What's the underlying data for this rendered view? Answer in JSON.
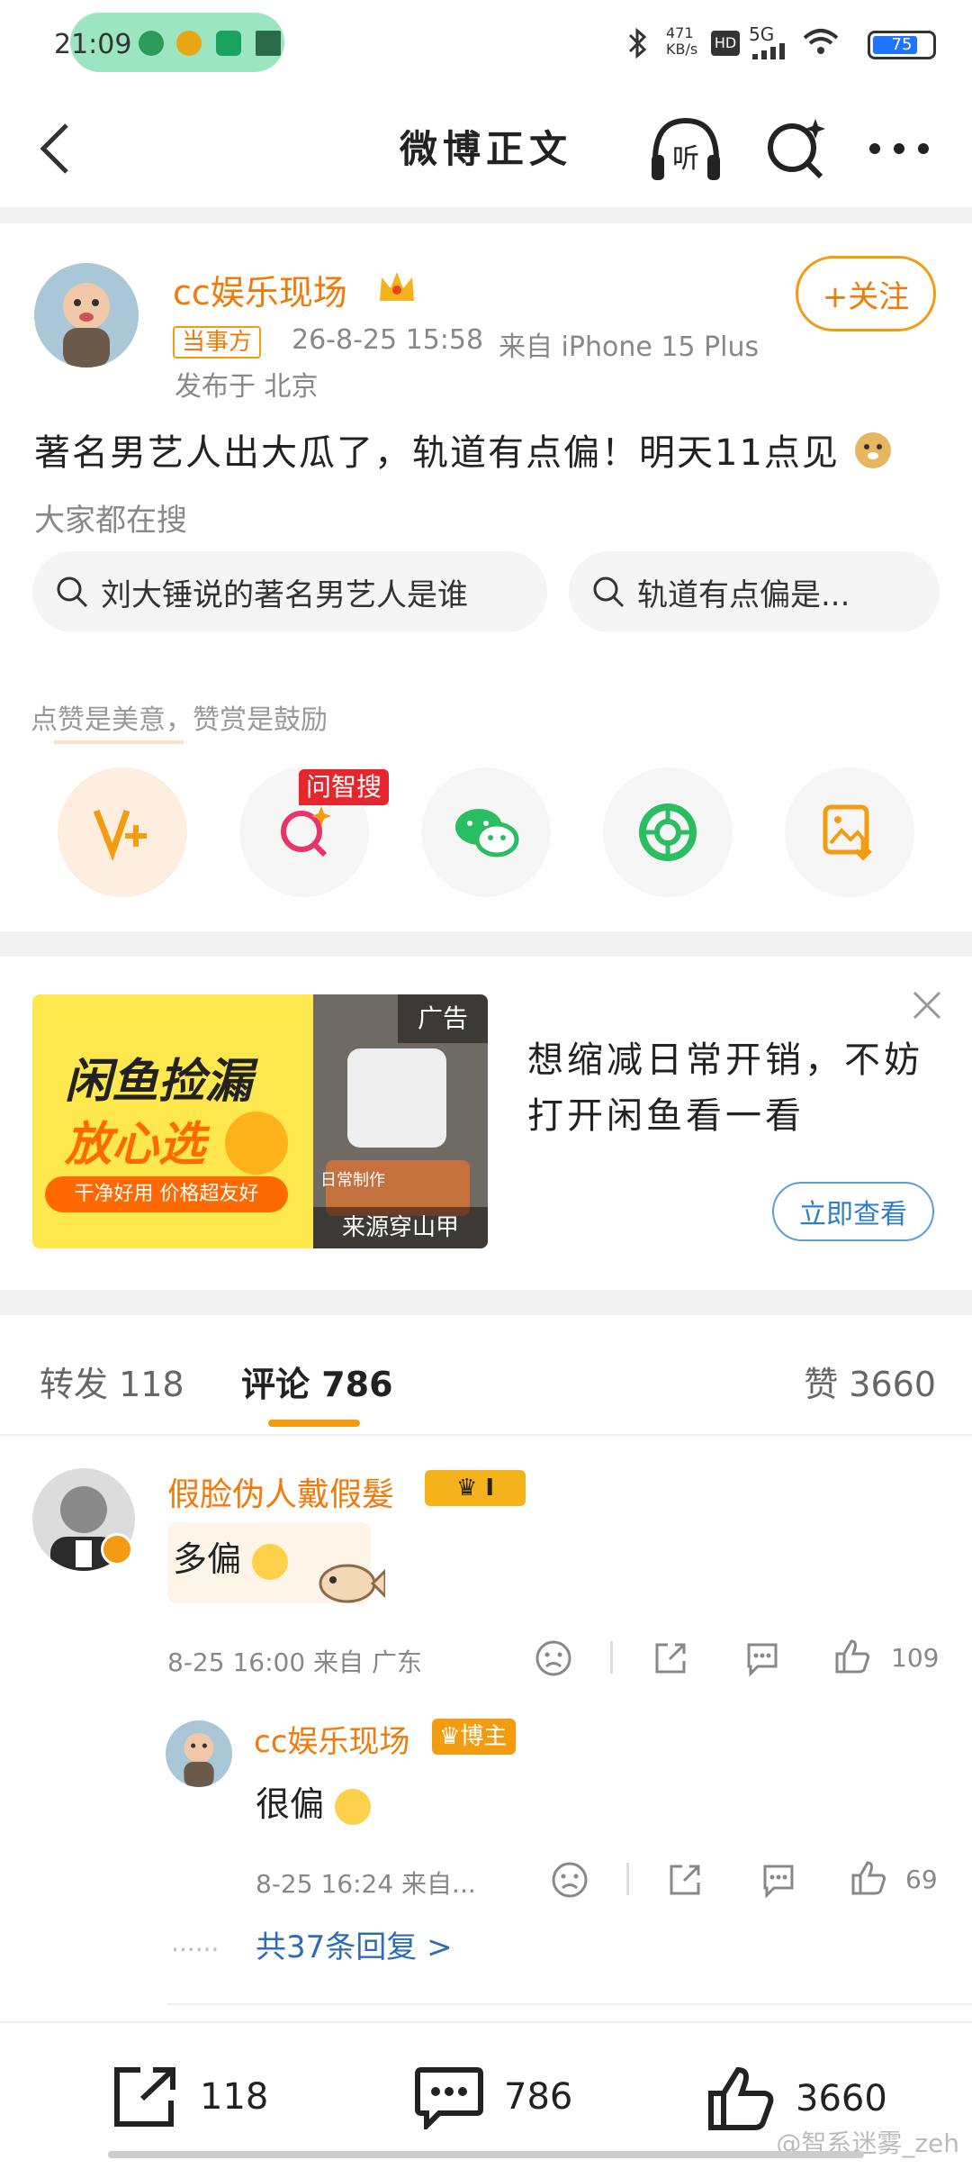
{
  "status_bar": {
    "time": "21:09",
    "network_speed": "471 KB/s",
    "hd": "HD",
    "signal": "5G",
    "battery": "75"
  },
  "header": {
    "title": "微博正文",
    "listen_label": "听"
  },
  "post": {
    "author": "cc娱乐现场",
    "tag": "当事方",
    "timestamp": "26-8-25 15:58",
    "source": "来自 iPhone 15 Plus",
    "location": "发布于 北京",
    "follow_label": "+关注",
    "text": "著名男艺人出大瓜了，轨道有点偏！明天11点见",
    "trending_label": "大家都在搜",
    "search_chips": [
      "刘大锤说的著名男艺人是谁",
      "轨道有点偏是..."
    ],
    "reward_hint": "点赞是美意，赞赏是鼓励",
    "badge_label": "问智搜"
  },
  "ad": {
    "banner_title_1": "闲鱼捡漏",
    "banner_title_2": "放心选",
    "banner_slogan": "干净好用 价格超友好",
    "ad_badge": "广告",
    "source": "来源穿山甲",
    "caption": "日常制作",
    "text": "想缩减日常开销，不妨打开闲鱼看一看",
    "button": "立即查看"
  },
  "tabs": {
    "repost": "转发 118",
    "comments": "评论 786",
    "likes": "赞 3660"
  },
  "comments": [
    {
      "name": "假脸伪人戴假髮",
      "level": "I",
      "text": "多偏",
      "meta": "8-25 16:00  来自 广东",
      "likes": "109"
    },
    {
      "name": "cc娱乐现场",
      "badge": "博主",
      "text": "很偏",
      "meta": "8-25 16:24  来自...",
      "likes": "69"
    }
  ],
  "more_replies": "共37条回复 >",
  "more_dots": "......",
  "bottom_bar": {
    "repost": "118",
    "comment": "786",
    "like": "3660"
  },
  "watermark": "@智系迷雾_zeh",
  "colors": {
    "accent": "#f07a0b",
    "link": "#2e7fc7",
    "pill": "#9be6c1"
  }
}
